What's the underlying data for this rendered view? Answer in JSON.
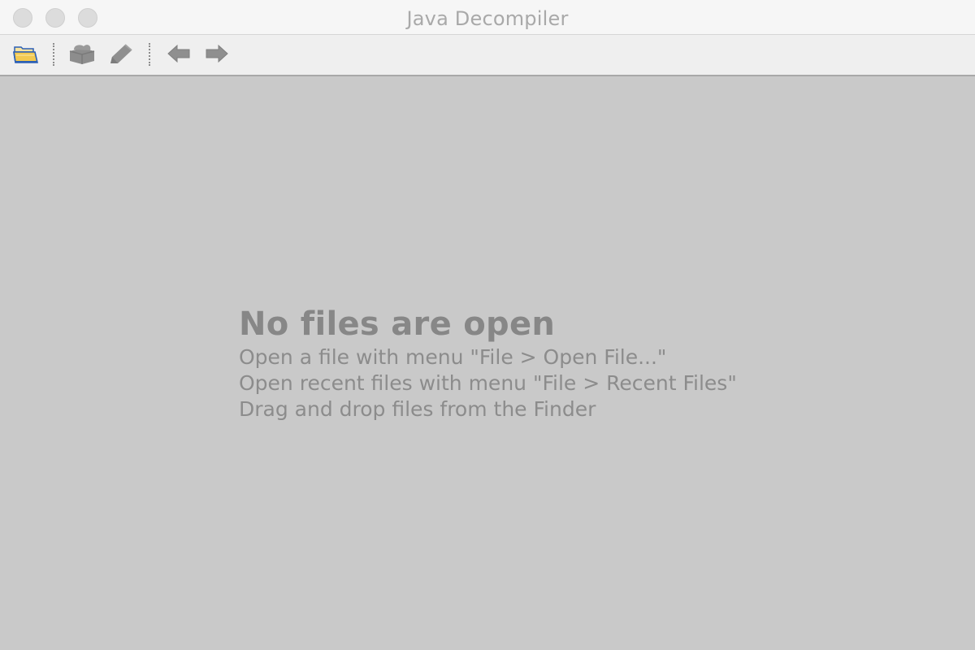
{
  "window": {
    "title": "Java Decompiler"
  },
  "toolbar": {
    "buttons": [
      {
        "name": "open-file",
        "icon": "open-folder-icon",
        "enabled": true
      },
      {
        "name": "open-type",
        "icon": "package-icon",
        "enabled": false
      },
      {
        "name": "search",
        "icon": "pencil-icon",
        "enabled": false
      },
      {
        "name": "back",
        "icon": "back-arrow-icon",
        "enabled": false
      },
      {
        "name": "forward",
        "icon": "forward-arrow-icon",
        "enabled": false
      }
    ]
  },
  "empty_state": {
    "headline": "No files are open",
    "lines": [
      "Open a file with menu \"File > Open File...\"",
      "Open recent files with menu \"File > Recent Files\"",
      "Drag and drop files from the Finder"
    ]
  },
  "colors": {
    "content_background": "#c9c9c9",
    "titlebar_background": "#f6f6f6",
    "toolbar_background": "#efefef",
    "muted_text": "#8a8a8a",
    "folder_accent": "#f3c94f",
    "folder_outline": "#2b5fb5"
  }
}
